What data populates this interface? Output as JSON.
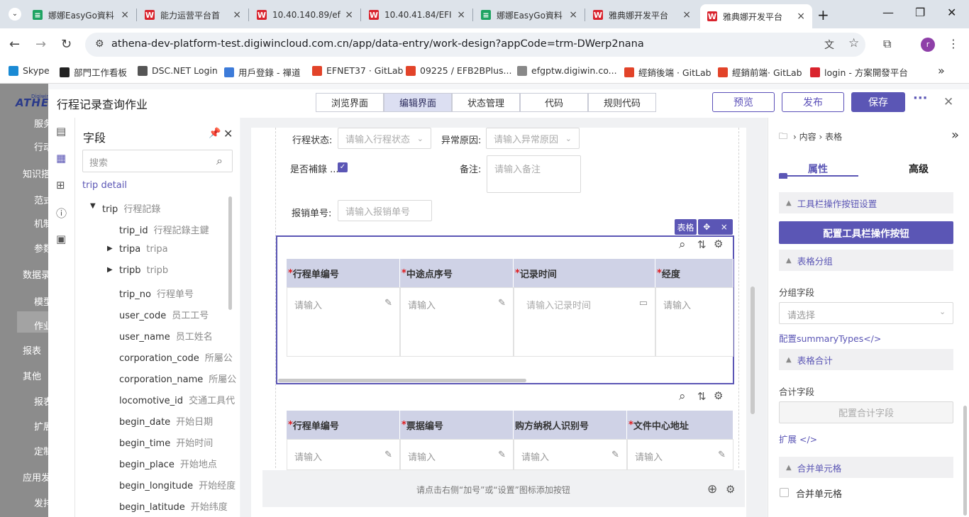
{
  "browser": {
    "tabs": [
      {
        "title": "娜娜EasyGo資料",
        "icon_color": "#1ea362",
        "icon": "sheet-icon"
      },
      {
        "title": "能力运营平台首",
        "icon_color": "#d9232d",
        "icon": "athena-icon"
      },
      {
        "title": "10.40.140.89/ef",
        "icon_color": "#d9232d",
        "icon": "athena-icon"
      },
      {
        "title": "10.40.41.84/EFI",
        "icon_color": "#d9232d",
        "icon": "athena-icon"
      },
      {
        "title": "娜娜EasyGo資料",
        "icon_color": "#1ea362",
        "icon": "sheet-icon"
      },
      {
        "title": "雅典娜开发平台",
        "icon_color": "#d9232d",
        "icon": "athena-icon"
      },
      {
        "title": "雅典娜开发平台",
        "icon_color": "#d9232d",
        "icon": "athena-icon",
        "active": true
      }
    ],
    "url": "athena-dev-platform-test.digiwincloud.com.cn/app/data-entry/work-design?appCode=trm-DWerp2nana",
    "profile_initial": "r",
    "bookmarks": [
      {
        "label": "Skype",
        "color": "#1a8ad4"
      },
      {
        "label": "部門工作看板",
        "color": "#222222"
      },
      {
        "label": "DSC.NET Login",
        "color": "#555555"
      },
      {
        "label": "用戶登錄 - 禪道",
        "color": "#3d7bd9"
      },
      {
        "label": "EFNET37 · GitLab",
        "color": "#e24329"
      },
      {
        "label": "09225 / EFB2BPlus...",
        "color": "#e24329"
      },
      {
        "label": "efgptw.digiwin.co...",
        "color": "#888888"
      },
      {
        "label": "經銷後端 · GitLab",
        "color": "#e24329"
      },
      {
        "label": "經銷前端· GitLab",
        "color": "#e24329"
      },
      {
        "label": "login - 方案開發平台",
        "color": "#d9232d"
      }
    ]
  },
  "leftnav": {
    "logo": "ATHE",
    "logo_small": "Digiwin",
    "items": [
      "服务",
      "行动",
      "知识搭",
      "范式",
      "机制",
      "参数",
      "数据录",
      "模型",
      "作业",
      "报表",
      "其他",
      "报表",
      "扩展",
      "定制",
      "应用发",
      "发排"
    ]
  },
  "header": {
    "title": "行程记录查询作业",
    "segments": [
      "浏览界面",
      "编辑界面",
      "状态管理",
      "代码",
      "规则代码"
    ],
    "active_segment": 1,
    "preview": "预览",
    "publish": "发布",
    "save": "保存",
    "more": "···"
  },
  "fieldpanel": {
    "title": "字段",
    "search_placeholder": "搜索",
    "root": {
      "code": "trip",
      "name": "detail"
    },
    "items": [
      {
        "code": "trip",
        "name": "行程記錄",
        "level": 1,
        "expand": "▼"
      },
      {
        "code": "trip_id",
        "name": "行程記錄主鍵",
        "level": 2
      },
      {
        "code": "tripa",
        "name": "tripa",
        "level": 2,
        "expand": "▶"
      },
      {
        "code": "tripb",
        "name": "tripb",
        "level": 2,
        "expand": "▶"
      },
      {
        "code": "trip_no",
        "name": "行程单号",
        "level": 2
      },
      {
        "code": "user_code",
        "name": "员工工号",
        "level": 2
      },
      {
        "code": "user_name",
        "name": "员工姓名",
        "level": 2
      },
      {
        "code": "corporation_code",
        "name": "所屬公",
        "level": 2
      },
      {
        "code": "corporation_name",
        "name": "所屬公",
        "level": 2
      },
      {
        "code": "locomotive_id",
        "name": "交通工具代",
        "level": 2
      },
      {
        "code": "begin_date",
        "name": "开始日期",
        "level": 2
      },
      {
        "code": "begin_time",
        "name": "开始时间",
        "level": 2
      },
      {
        "code": "begin_place",
        "name": "开始地点",
        "level": 2
      },
      {
        "code": "begin_longitude",
        "name": "开始经度",
        "level": 2
      },
      {
        "code": "begin_latitude",
        "name": "开始纬度",
        "level": 2
      }
    ]
  },
  "form": {
    "trip_status_label": "行程状态:",
    "trip_status_placeholder": "请输入行程状态",
    "abnormal_label": "异常原因:",
    "abnormal_placeholder": "请输入异常原因",
    "supplement_label": "是否補錄 ...",
    "remark_label": "备注:",
    "remark_placeholder": "请输入备注",
    "reimburse_label": "报销单号:",
    "reimburse_placeholder": "请输入报销单号"
  },
  "table1": {
    "tag": "表格",
    "move": "✥",
    "close": "×",
    "columns": [
      {
        "title": "行程单编号",
        "placeholder": "请输入",
        "icon": "✎"
      },
      {
        "title": "中途点序号",
        "placeholder": "请输入",
        "icon": "✎"
      },
      {
        "title": "记录时间",
        "placeholder": "请输入记录时间",
        "icon": "▭"
      },
      {
        "title": "经度",
        "placeholder": "请输入",
        "icon": ""
      }
    ],
    "required_mark": "*"
  },
  "table2": {
    "columns": [
      {
        "title": "行程单编号",
        "placeholder": "请输入",
        "required": true
      },
      {
        "title": "票据编号",
        "placeholder": "请输入",
        "required": true
      },
      {
        "title": "购方纳税人识别号",
        "placeholder": "请输入",
        "required": false
      },
      {
        "title": "文件中心地址",
        "placeholder": "请输入",
        "required": true
      }
    ]
  },
  "bottom_hint": "请点击右侧“加号”或“设置”图标添加按钮",
  "rightpanel": {
    "breadcrumb_1": "内容",
    "breadcrumb_2": "表格",
    "tab_props": "属性",
    "tab_advanced": "高级",
    "toolbar_section": "工具栏操作按钮设置",
    "config_toolbar_btn": "配置工具栏操作按钮",
    "group_section": "表格分组",
    "group_field_label": "分组字段",
    "group_select_placeholder": "请选择",
    "summary_link": "配置summaryTypes</>",
    "total_section": "表格合计",
    "total_field_label": "合计字段",
    "config_total_btn": "配置合计字段",
    "extend_link": "扩展 </>",
    "merge_section": "合并单元格",
    "merge_checkbox": "合并单元格"
  }
}
